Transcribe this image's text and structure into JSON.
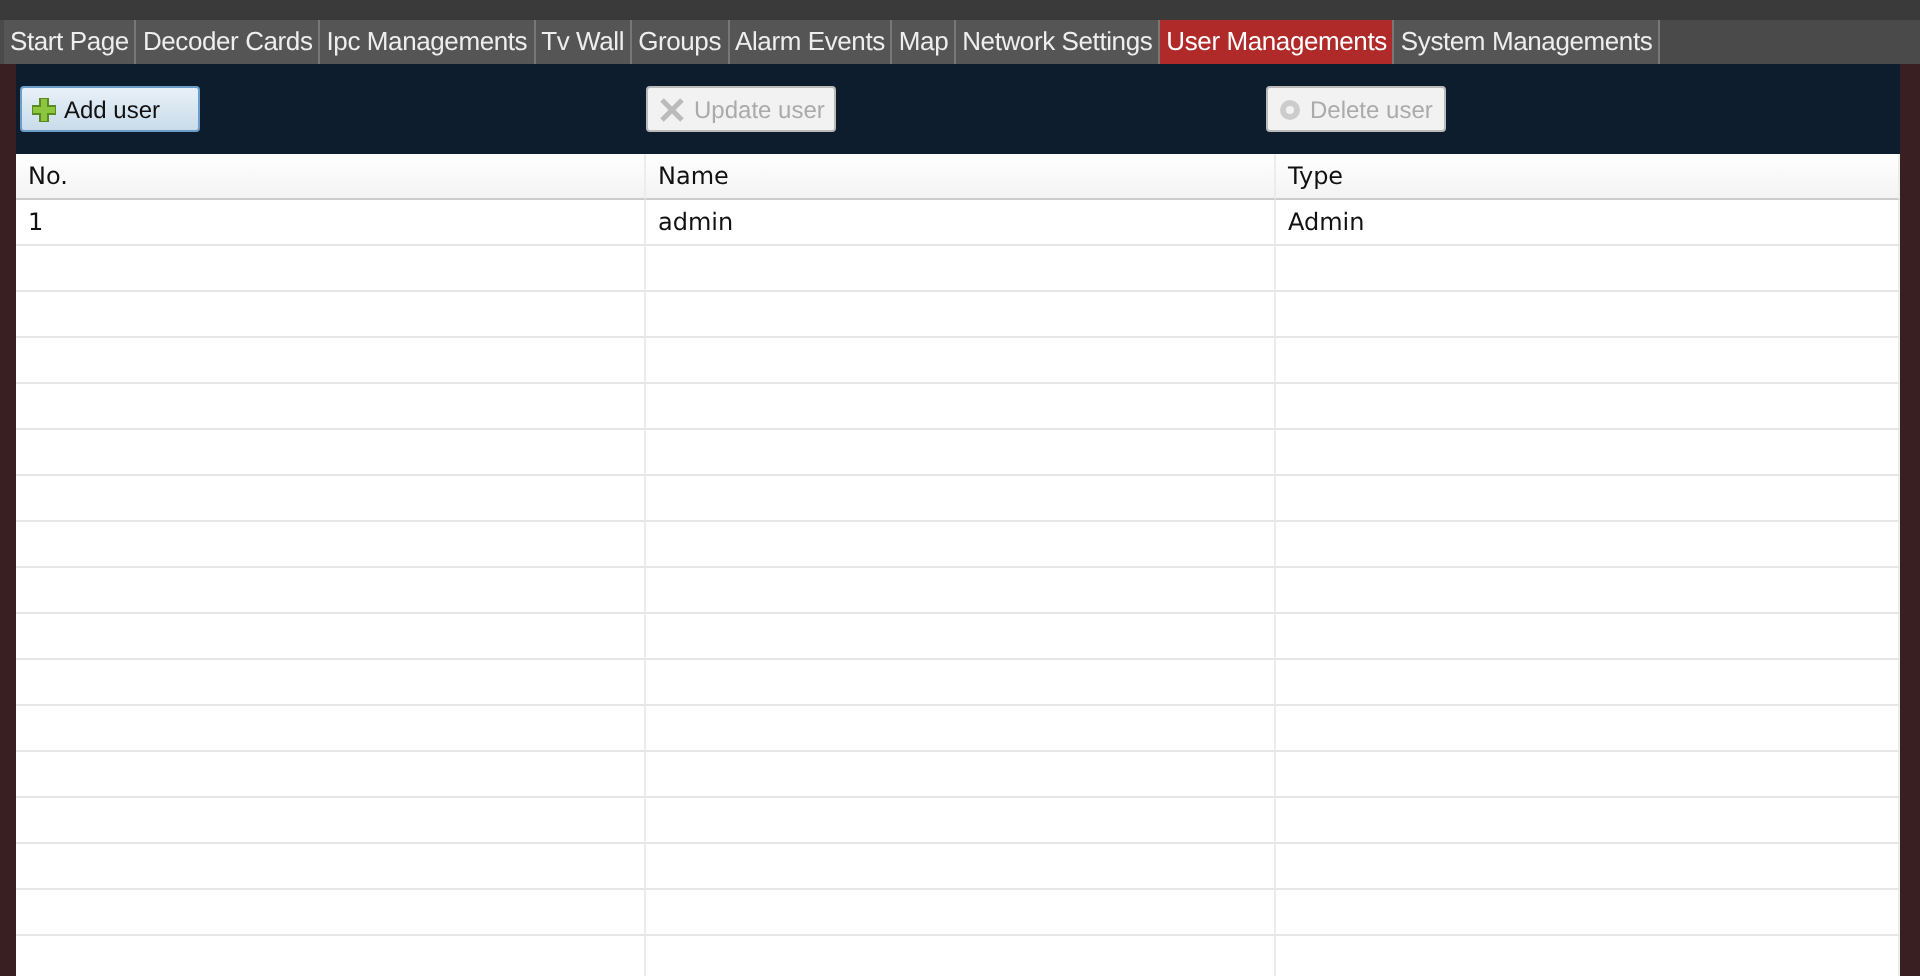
{
  "tabs": [
    {
      "label": "Start Page",
      "selected": false
    },
    {
      "label": "Decoder Cards",
      "selected": false
    },
    {
      "label": "Ipc Managements",
      "selected": false
    },
    {
      "label": "Tv Wall",
      "selected": false
    },
    {
      "label": "Groups",
      "selected": false
    },
    {
      "label": "Alarm Events",
      "selected": false
    },
    {
      "label": "Map",
      "selected": false
    },
    {
      "label": "Network Settings",
      "selected": false
    },
    {
      "label": "User Managements",
      "selected": true
    },
    {
      "label": "System Managements",
      "selected": false
    }
  ],
  "toolbar": [
    {
      "kind": "add",
      "label": "Add user",
      "disabled": false
    },
    {
      "kind": "update",
      "label": "Update user",
      "disabled": true
    },
    {
      "kind": "delete",
      "label": "Delete user",
      "disabled": true
    }
  ],
  "table": {
    "columns": [
      "No.",
      "Name",
      "Type"
    ],
    "rows": [
      [
        "1",
        "admin",
        "Admin"
      ]
    ]
  }
}
